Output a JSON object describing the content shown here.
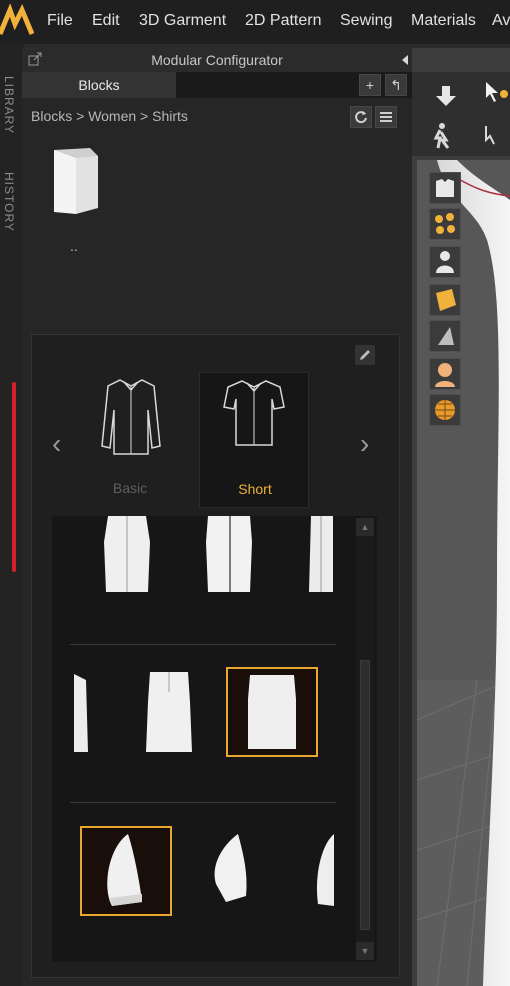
{
  "menubar": {
    "items": [
      "File",
      "Edit",
      "3D Garment",
      "2D Pattern",
      "Sewing",
      "Materials",
      "Av"
    ]
  },
  "side_tabs": [
    "LIBRARY",
    "HISTORY"
  ],
  "panel": {
    "title": "Modular Configurator",
    "tab": "Blocks",
    "add_label": "+",
    "back_label": "↰",
    "breadcrumb": "Blocks > Women > Shirts",
    "folder_label": ".."
  },
  "styles": {
    "prev": "‹",
    "next": "›",
    "items": [
      {
        "label": "Basic",
        "selected": false
      },
      {
        "label": "Short",
        "selected": true
      }
    ]
  },
  "colors": {
    "accent": "#e9a730",
    "selected_text": "#f0b23a",
    "inactive_text": "#5e5e5e",
    "marker": "#d4202a"
  },
  "icons": [
    "logo-icon",
    "popout-icon",
    "pin-icon",
    "refresh-icon",
    "list-icon",
    "edit-icon",
    "folder-icon",
    "arrow-down-icon",
    "select-icon",
    "avatar-walk-icon",
    "rotate-icon"
  ]
}
